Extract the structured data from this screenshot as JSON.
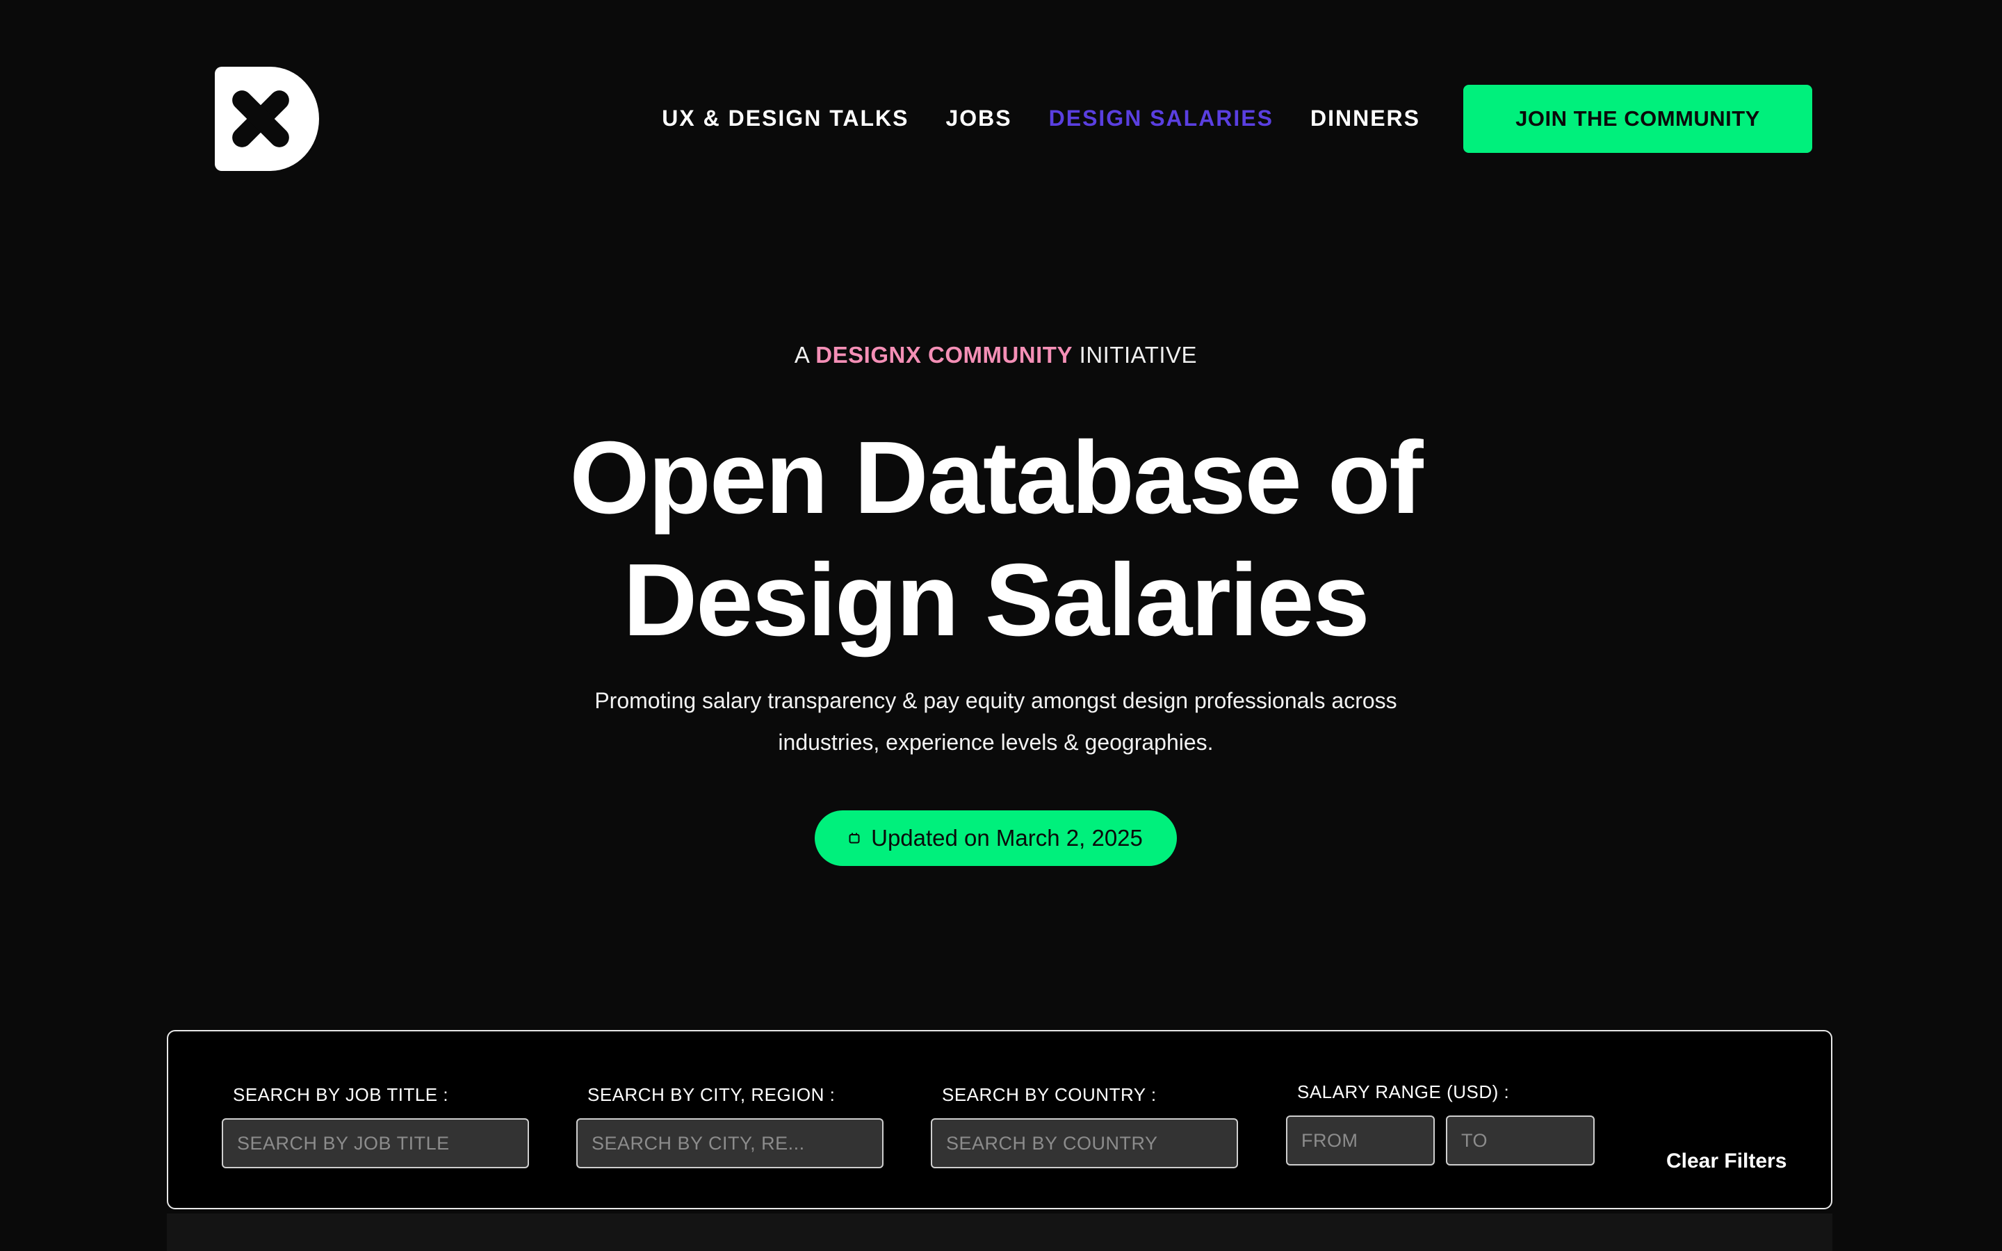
{
  "header": {
    "logo_icon": "designx-logo-icon",
    "nav": [
      {
        "label": "UX & DESIGN TALKS",
        "active": false
      },
      {
        "label": "JOBS",
        "active": false
      },
      {
        "label": "DESIGN SALARIES",
        "active": true
      },
      {
        "label": "DINNERS",
        "active": false
      }
    ],
    "cta_label": "JOIN THE COMMUNITY"
  },
  "hero": {
    "eyebrow_prefix": "A",
    "eyebrow_highlight": "DESIGNX COMMUNITY",
    "eyebrow_suffix": "INITIATIVE",
    "title_line1": "Open Database of",
    "title_line2": "Design Salaries",
    "subtitle": "Promoting salary transparency & pay equity amongst design professionals across industries, experience levels & geographies.",
    "updated_label": "Updated on March 2, 2025",
    "updated_icon": "calendar-icon"
  },
  "filters": {
    "job_title": {
      "label": "SEARCH BY JOB TITLE :",
      "placeholder": "SEARCH BY JOB TITLE",
      "value": ""
    },
    "city": {
      "label": "SEARCH BY CITY, REGION :",
      "placeholder": "SEARCH BY CITY, RE...",
      "value": ""
    },
    "country": {
      "label": "SEARCH BY COUNTRY :",
      "placeholder": "SEARCH BY COUNTRY",
      "value": ""
    },
    "salary": {
      "label": "SALARY RANGE (USD) :",
      "from_placeholder": "FROM",
      "to_placeholder": "TO"
    },
    "clear_label": "Clear Filters"
  },
  "colors": {
    "background": "#0a0a0a",
    "accent_green": "#00f07c",
    "active_nav": "#5a3fe0",
    "highlight_pink": "#f48fb6"
  }
}
